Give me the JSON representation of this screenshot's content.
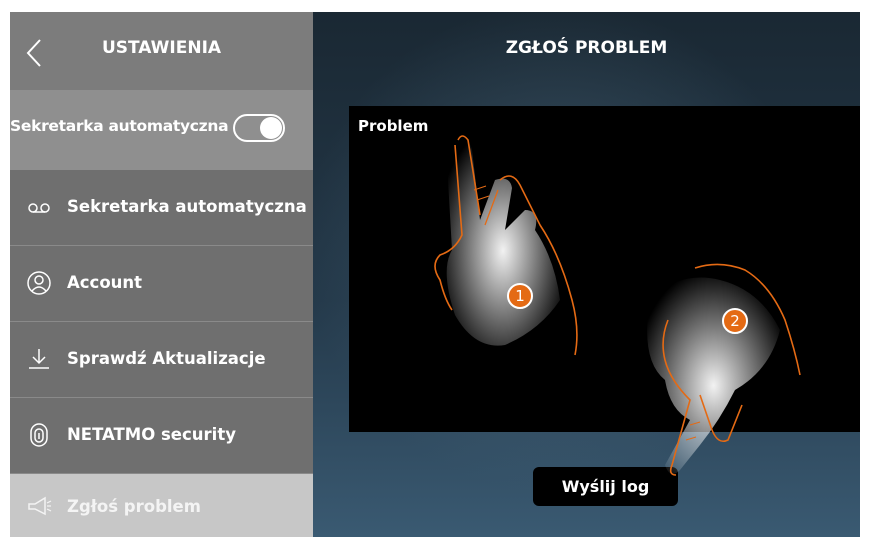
{
  "sidebar": {
    "title": "USTAWIENIA",
    "toggle_label": "Sekretarka automatyczna",
    "toggle_on": true,
    "items": [
      {
        "label": "Sekretarka automatyczna",
        "icon": "voicemail-icon"
      },
      {
        "label": "Account",
        "icon": "user-circle-icon"
      },
      {
        "label": "Sprawdź Aktualizacje",
        "icon": "download-icon"
      },
      {
        "label": "NETATMO security",
        "icon": "fingerprint-icon"
      },
      {
        "label": "Zgłoś problem",
        "icon": "megaphone-icon",
        "active": true
      }
    ]
  },
  "main": {
    "title": "ZGŁOŚ PROBLEM",
    "box_label": "Problem",
    "send_label": "Wyślij log"
  },
  "annotations": {
    "step1": "1",
    "step2": "2"
  },
  "colors": {
    "sidebar_bg": "#6f6f6f",
    "toggle_row_bg": "#8f8f8f",
    "active_item_bg": "#c7c7c7",
    "accent_orange": "#e46a14"
  }
}
